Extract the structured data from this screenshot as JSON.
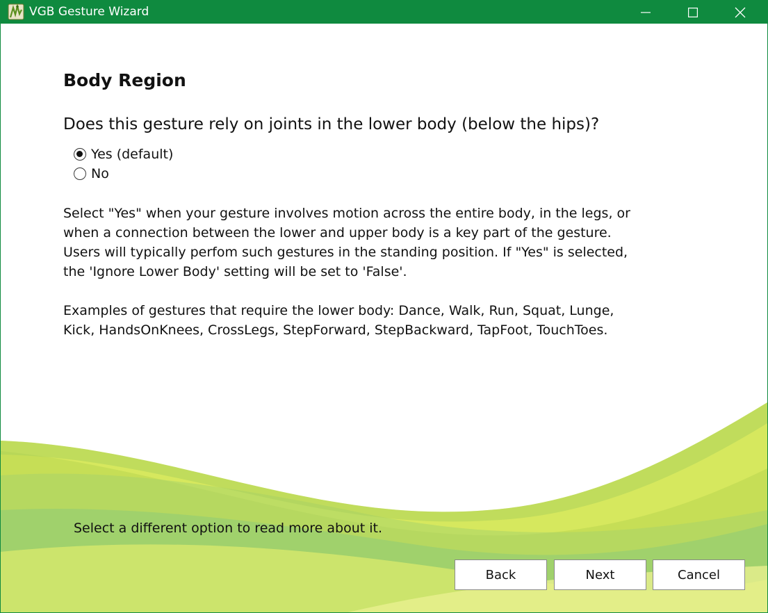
{
  "window": {
    "title": "VGB Gesture Wizard",
    "titlebar_color": "#0f8a3f",
    "icons": {
      "app": "vgb-app-icon",
      "minimize": "minimize-icon",
      "maximize": "maximize-icon",
      "close": "close-icon"
    }
  },
  "page": {
    "heading": "Body Region",
    "question": "Does this gesture rely on joints in the lower body (below the hips)?",
    "options": [
      {
        "label": "Yes (default)",
        "selected": true
      },
      {
        "label": "No",
        "selected": false
      }
    ],
    "description": "Select \"Yes\" when your gesture involves motion across the entire body, in the legs, or when a connection between the lower and upper body is a key part of the gesture. Users will typically perfom such gestures in the standing position. If \"Yes\" is selected, the 'Ignore Lower Body' setting will be set to 'False'.",
    "examples": "Examples of gestures that require the lower body: Dance, Walk, Run, Squat, Lunge, Kick, HandsOnKnees, CrossLegs, StepForward, StepBackward, TapFoot, TouchToes.",
    "footer_message": "Select a different option to read more about it."
  },
  "buttons": {
    "back": "Back",
    "next": "Next",
    "cancel": "Cancel"
  }
}
